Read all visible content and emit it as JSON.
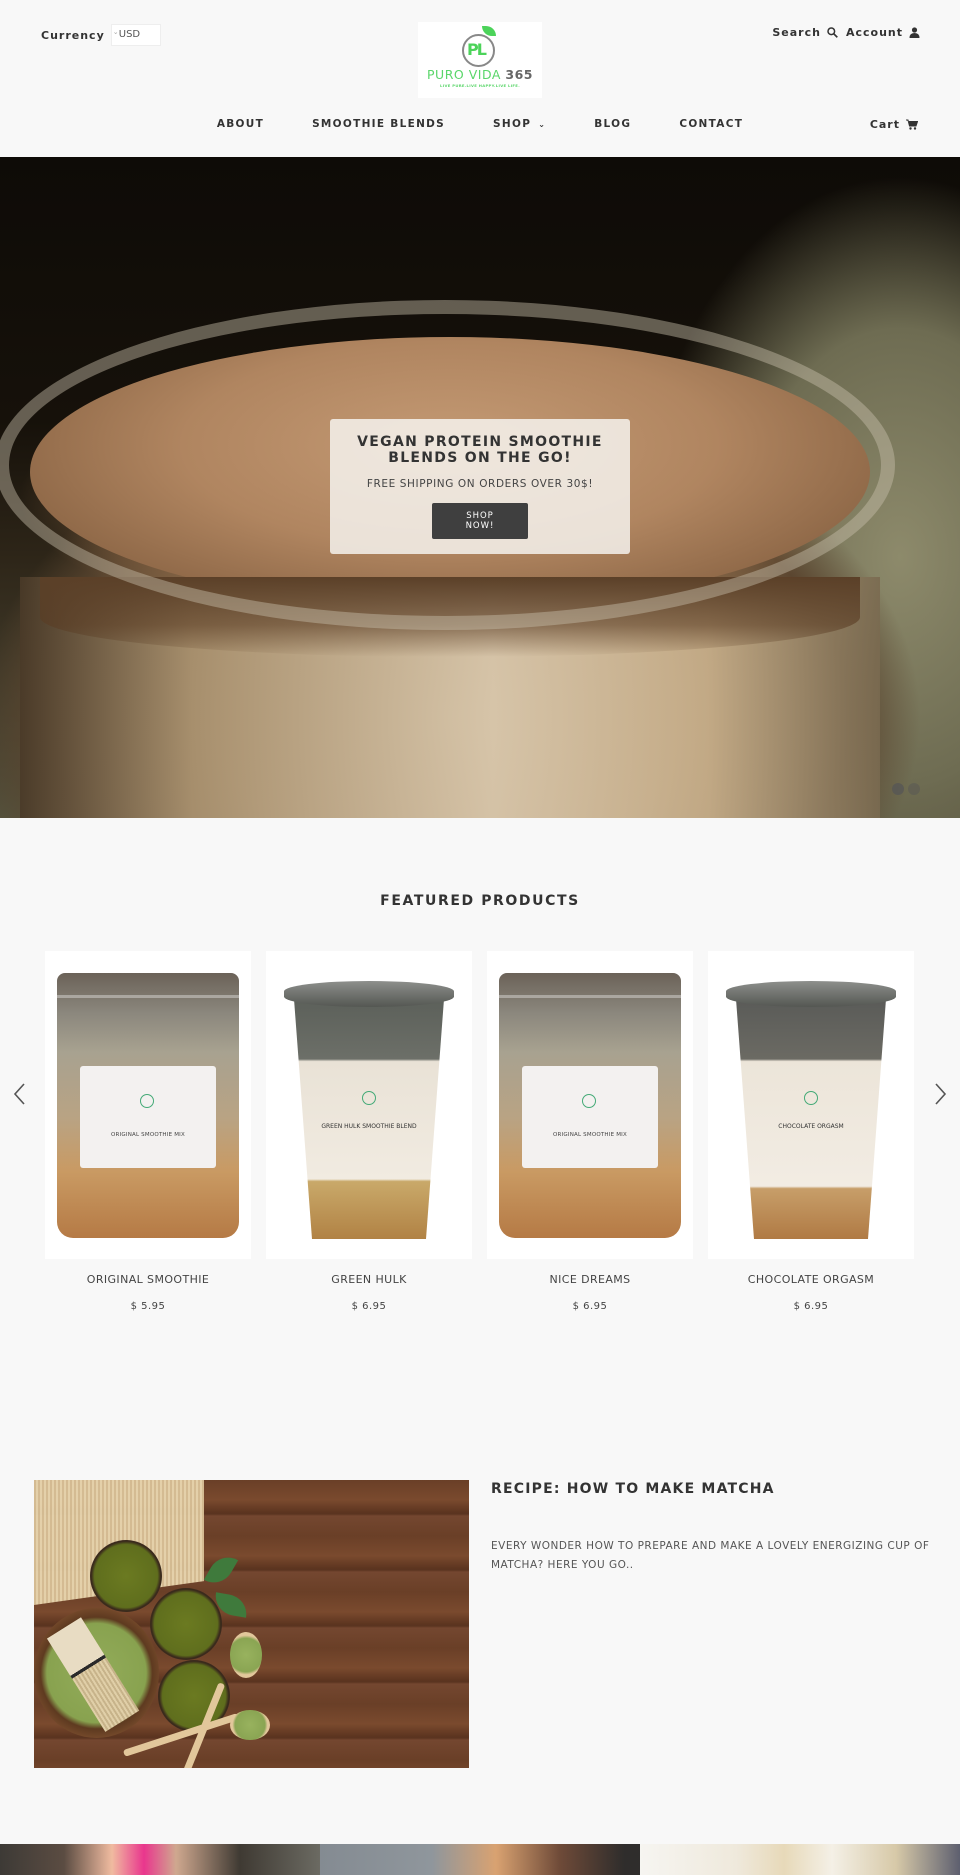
{
  "header": {
    "currency_label": "Currency",
    "currency_value": "USD",
    "logo": {
      "mark": "PL",
      "name_main": "PURO VIDA",
      "name_num": "365",
      "tagline": "LIVE PURE.LIVE HAPPY.LIVE LIFE."
    },
    "search_label": "Search",
    "account_label": "Account",
    "cart_label": "Cart"
  },
  "nav": {
    "items": [
      {
        "label": "ABOUT"
      },
      {
        "label": "SMOOTHIE BLENDS"
      },
      {
        "label": "SHOP",
        "has_dropdown": true
      },
      {
        "label": "BLOG"
      },
      {
        "label": "CONTACT"
      }
    ]
  },
  "hero": {
    "title": "VEGAN PROTEIN SMOOTHIE BLENDS ON THE GO!",
    "subtitle": "FREE SHIPPING ON ORDERS OVER 30$!",
    "button_label_line1": "SHOP",
    "button_label_line2": "NOW!",
    "slides_total": 2,
    "active_slide": 1
  },
  "featured": {
    "title": "FEATURED PRODUCTS",
    "products": [
      {
        "name": "ORIGINAL SMOOTHIE",
        "price": "$ 5.95",
        "image": "pouch",
        "label_text": "ORIGINAL SMOOTHIE MIX"
      },
      {
        "name": "GREEN HULK",
        "price": "$ 6.95",
        "image": "cup",
        "label_text": "GREEN HULK SMOOTHIE BLEND"
      },
      {
        "name": "NICE DREAMS",
        "price": "$ 6.95",
        "image": "pouch",
        "label_text": "ORIGINAL SMOOTHIE MIX"
      },
      {
        "name": "CHOCOLATE ORGASM",
        "price": "$ 6.95",
        "image": "cup",
        "label_text": "CHOCOLATE ORGASM"
      }
    ]
  },
  "recipe": {
    "title": "RECIPE: HOW TO MAKE MATCHA",
    "excerpt": "EVERY WONDER HOW TO PREPARE AND MAKE A LOVELY ENERGIZING CUP OF MATCHA? HERE YOU GO.."
  },
  "colors": {
    "background": "#f8f8f8",
    "text": "#333333",
    "button_dark": "#3f3f3f",
    "logo_green": "#4cd35a"
  }
}
